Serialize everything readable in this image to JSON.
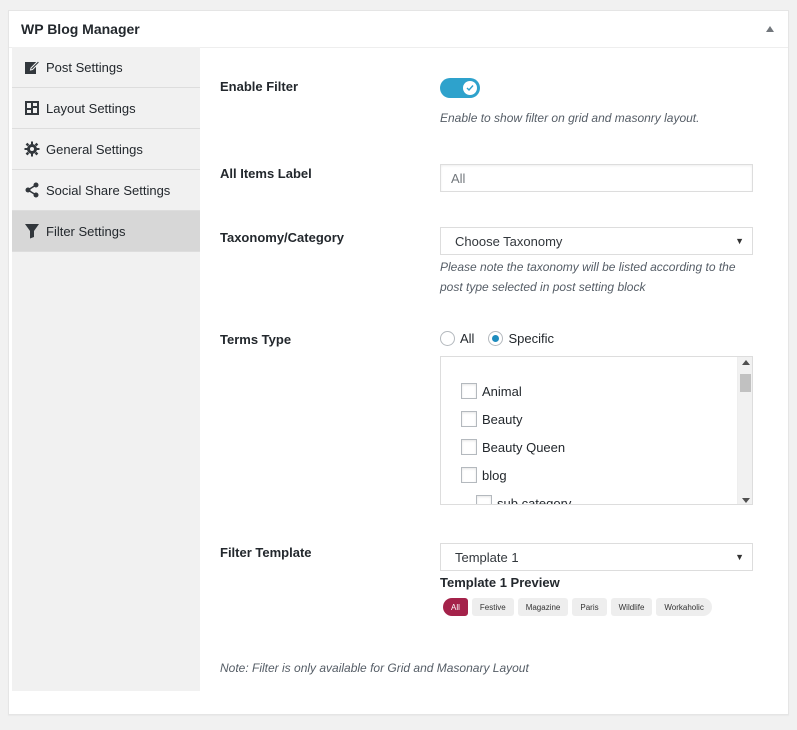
{
  "panel": {
    "title": "WP Blog Manager"
  },
  "sidebar": {
    "items": [
      {
        "label": "Post Settings",
        "icon": "edit-icon"
      },
      {
        "label": "Layout Settings",
        "icon": "layout-icon"
      },
      {
        "label": "General Settings",
        "icon": "gear-icon"
      },
      {
        "label": "Social Share Settings",
        "icon": "share-icon"
      },
      {
        "label": "Filter Settings",
        "icon": "filter-icon",
        "active": true
      }
    ]
  },
  "enable_filter": {
    "label": "Enable Filter",
    "enabled": true,
    "description": "Enable to show filter on grid and masonry layout."
  },
  "all_items_label": {
    "label": "All Items Label",
    "placeholder": "All"
  },
  "taxonomy": {
    "label": "Taxonomy/Category",
    "selected": "Choose Taxonomy",
    "description": "Please note the taxonomy will be listed according to the post type selected in post setting block"
  },
  "terms_type": {
    "label": "Terms Type",
    "options": [
      "All",
      "Specific"
    ],
    "selected": "Specific",
    "terms": [
      {
        "label": "Animal",
        "checked": false
      },
      {
        "label": "Beauty",
        "checked": false
      },
      {
        "label": "Beauty Queen",
        "checked": false
      },
      {
        "label": "blog",
        "checked": false
      },
      {
        "label": "sub category",
        "checked": false,
        "child": true
      }
    ]
  },
  "filter_template": {
    "label": "Filter Template",
    "selected": "Template 1",
    "preview_title": "Template 1 Preview",
    "preview_pills": [
      "All",
      "Festive",
      "Magazine",
      "Paris",
      "Wildlife",
      "Workaholic"
    ]
  },
  "note": "Note: Filter is only available for Grid and Masonary Layout",
  "colors": {
    "accent": "#2ea2cc",
    "pill_active": "#a4224a",
    "sidebar_bg": "#f1f1f1",
    "active_item_bg": "#d7d7d7"
  }
}
